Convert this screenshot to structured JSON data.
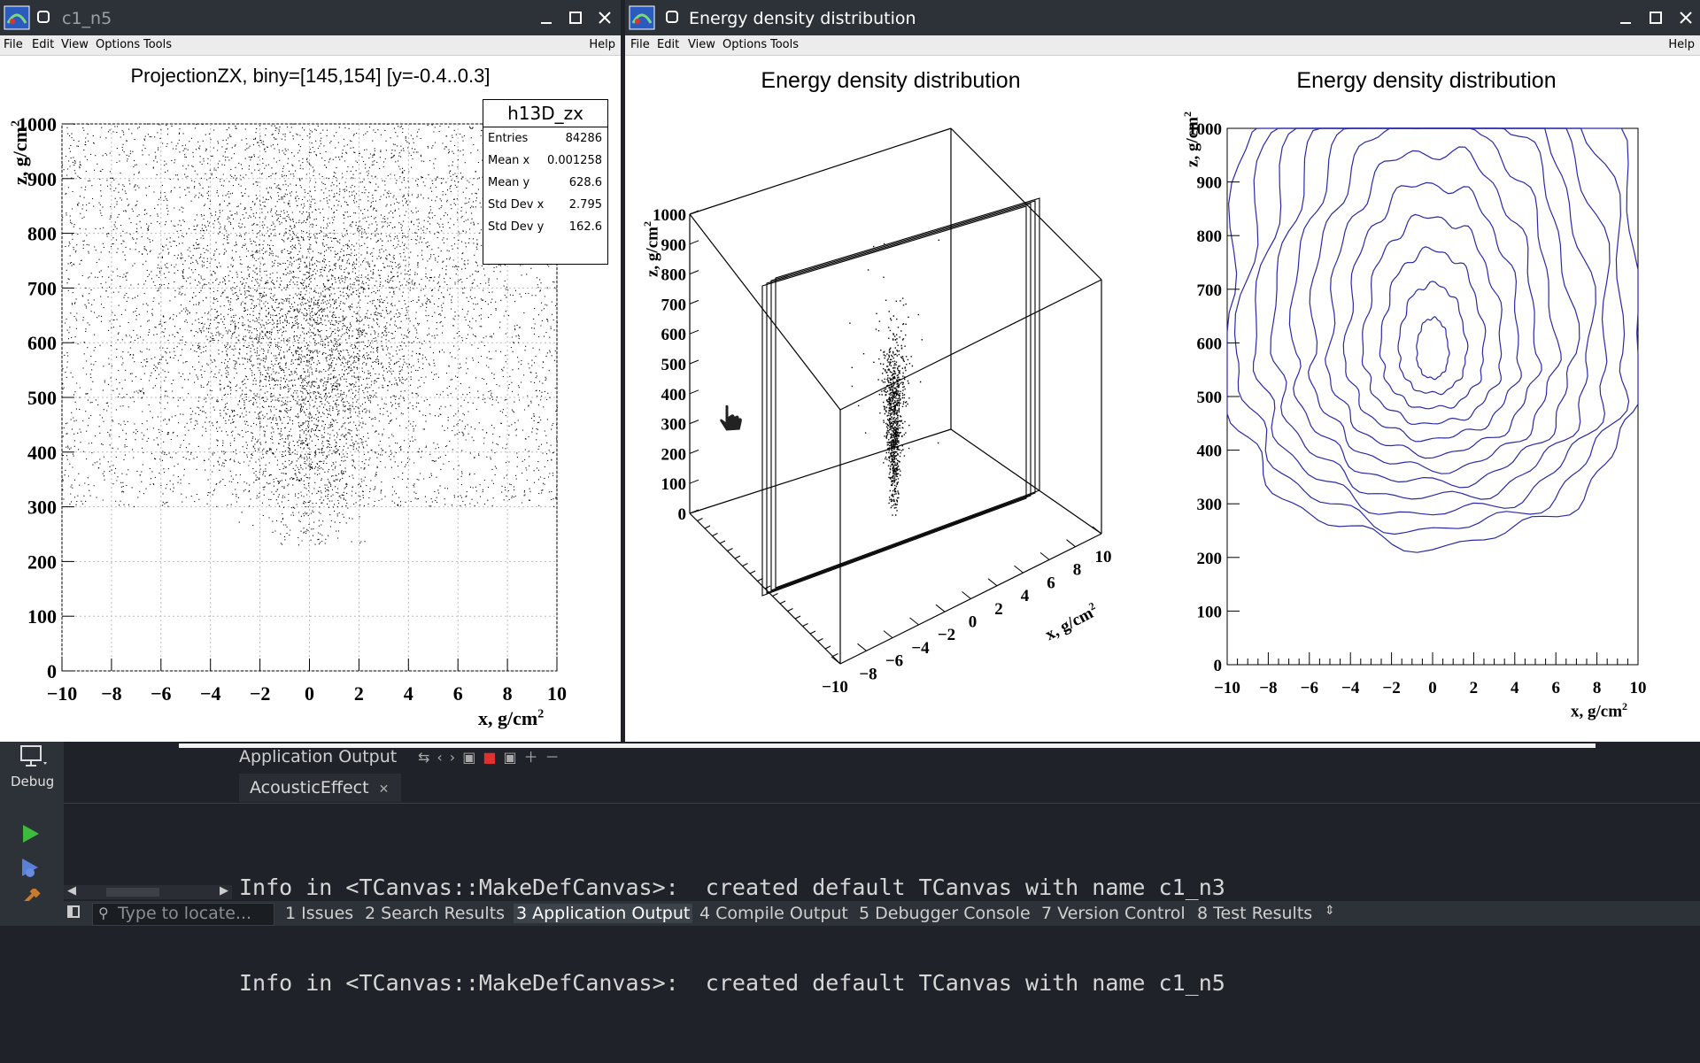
{
  "windows": {
    "left": {
      "title": "c1_n5",
      "menu": [
        "File",
        "Edit",
        "View",
        "Options",
        "Tools"
      ],
      "help": "Help",
      "plot_title": "ProjectionZX, biny=[145,154] [y=-0.4..0.3]",
      "stats": {
        "name": "h13D_zx",
        "rows": [
          {
            "label": "Entries",
            "value": "84286"
          },
          {
            "label": "Mean x",
            "value": "0.001258"
          },
          {
            "label": "Mean y",
            "value": "628.6"
          },
          {
            "label": "Std Dev x",
            "value": "2.795"
          },
          {
            "label": "Std Dev y",
            "value": "162.6"
          }
        ]
      }
    },
    "right": {
      "title": "Energy density distribution",
      "menu": [
        "File",
        "Edit",
        "View",
        "Options",
        "Tools"
      ],
      "help": "Help"
    }
  },
  "chart_data": [
    {
      "type": "scatter",
      "title": "ProjectionZX, biny=[145,154] [y=-0.4..0.3]",
      "xlabel": "x, g/cm2",
      "ylabel": "z, g/cm2",
      "xlim": [
        -10,
        10
      ],
      "ylim": [
        0,
        1000
      ],
      "x_ticks": [
        "−10",
        "−8",
        "−6",
        "−4",
        "−2",
        "0",
        "2",
        "4",
        "6",
        "8",
        "10"
      ],
      "y_ticks": [
        "0",
        "100",
        "200",
        "300",
        "400",
        "500",
        "600",
        "700",
        "800",
        "900",
        "1000"
      ],
      "grid": true,
      "entries": 84286,
      "mean_x": 0.001258,
      "mean_y": 628.6,
      "std_x": 2.795,
      "std_y": 162.6
    },
    {
      "type": "scatter",
      "title": "Energy density distribution",
      "xlabel": "x, g/cm2",
      "ylabel": "z, g/cm2",
      "xlim": [
        -10,
        10
      ],
      "zlim": [
        0,
        1000
      ],
      "x_ticks": [
        "−10",
        "−8",
        "−6",
        "−4",
        "−2",
        "0",
        "2",
        "4",
        "6",
        "8",
        "10"
      ],
      "z_ticks": [
        "0",
        "100",
        "200",
        "300",
        "400",
        "500",
        "600",
        "700",
        "800",
        "900",
        "1000"
      ],
      "view": "3d-box"
    },
    {
      "type": "heatmap",
      "title": "Energy density distribution",
      "xlabel": "x, g/cm2",
      "ylabel": "z, g/cm2",
      "xlim": [
        -10,
        10
      ],
      "ylim": [
        0,
        1000
      ],
      "x_ticks": [
        "−10",
        "−8",
        "−6",
        "−4",
        "−2",
        "0",
        "2",
        "4",
        "6",
        "8",
        "10"
      ],
      "y_ticks": [
        "0",
        "100",
        "200",
        "300",
        "400",
        "500",
        "600",
        "700",
        "800",
        "900",
        "1000"
      ],
      "style": "contour",
      "contour_levels": 12,
      "center": {
        "x": 0,
        "z": 580
      },
      "line_color": "#2a2aa8"
    }
  ],
  "ide": {
    "panel_title": "Application Output",
    "tab_label": "AcousticEffect",
    "sidebar_label": "Debug",
    "log_lines": [
      "Info in <TCanvas::MakeDefCanvas>:  created default TCanvas with name c1_n3",
      "Info in <TCanvas::MakeDefCanvas>:  created default TCanvas with name c1_n5"
    ],
    "search_placeholder": "Type to locate...",
    "status_tabs": [
      "1 Issues",
      "2 Search Results",
      "3 Application Output",
      "4 Compile Output",
      "5 Debugger Console",
      "7 Version Control",
      "8 Test Results"
    ]
  },
  "colors": {
    "accent": "#2a2aa8",
    "ide_bg": "#1f2329",
    "titlebar": "#2d3238",
    "run_green": "#3dbb3d"
  }
}
